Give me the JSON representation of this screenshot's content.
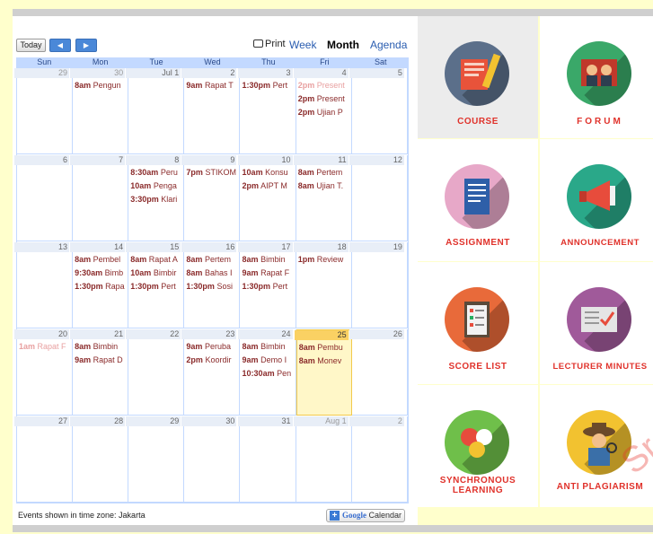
{
  "calendar": {
    "today_label": "Today",
    "print_label": "Print",
    "tabs": [
      "Week",
      "Month",
      "Agenda"
    ],
    "day_headers": [
      "Sun",
      "Mon",
      "Tue",
      "Wed",
      "Thu",
      "Fri",
      "Sat"
    ],
    "weeks": [
      [
        {
          "d": "29",
          "o": true,
          "ev": []
        },
        {
          "d": "30",
          "o": true,
          "ev": [
            [
              "8am",
              "Pengun"
            ]
          ]
        },
        {
          "d": "Jul 1",
          "ev": []
        },
        {
          "d": "2",
          "ev": [
            [
              "9am",
              "Rapat T"
            ]
          ]
        },
        {
          "d": "3",
          "ev": [
            [
              "1:30pm",
              "Pert"
            ]
          ]
        },
        {
          "d": "4",
          "ev": [
            [
              "2pm",
              "Present",
              true
            ],
            [
              "2pm",
              "Present"
            ],
            [
              "2pm",
              "Ujian P"
            ]
          ]
        },
        {
          "d": "5",
          "ev": []
        }
      ],
      [
        {
          "d": "6",
          "ev": []
        },
        {
          "d": "7",
          "ev": []
        },
        {
          "d": "8",
          "ev": [
            [
              "8:30am",
              "Peru"
            ],
            [
              "10am",
              "Penga"
            ],
            [
              "3:30pm",
              "Klari"
            ]
          ]
        },
        {
          "d": "9",
          "ev": [
            [
              "7pm",
              "STIKOM"
            ]
          ]
        },
        {
          "d": "10",
          "ev": [
            [
              "10am",
              "Konsu"
            ],
            [
              "2pm",
              "AIPT M"
            ]
          ]
        },
        {
          "d": "11",
          "ev": [
            [
              "8am",
              "Pertem"
            ],
            [
              "8am",
              "Ujian T."
            ]
          ]
        },
        {
          "d": "12",
          "ev": []
        }
      ],
      [
        {
          "d": "13",
          "ev": []
        },
        {
          "d": "14",
          "ev": [
            [
              "8am",
              "Pembel"
            ],
            [
              "9:30am",
              "Bimb"
            ],
            [
              "1:30pm",
              "Rapa"
            ]
          ]
        },
        {
          "d": "15",
          "ev": [
            [
              "8am",
              "Rapat A"
            ],
            [
              "10am",
              "Bimbir"
            ],
            [
              "1:30pm",
              "Pert"
            ]
          ]
        },
        {
          "d": "16",
          "ev": [
            [
              "8am",
              "Pertem"
            ],
            [
              "8am",
              "Bahas I"
            ],
            [
              "1:30pm",
              "Sosi"
            ]
          ]
        },
        {
          "d": "17",
          "ev": [
            [
              "8am",
              "Bimbin"
            ],
            [
              "9am",
              "Rapat F"
            ],
            [
              "1:30pm",
              "Pert"
            ]
          ]
        },
        {
          "d": "18",
          "ev": [
            [
              "1pm",
              "Review"
            ]
          ]
        },
        {
          "d": "19",
          "ev": []
        }
      ],
      [
        {
          "d": "20",
          "ev": [
            [
              "1am",
              "Rapat F",
              true
            ]
          ]
        },
        {
          "d": "21",
          "ev": [
            [
              "8am",
              "Bimbin"
            ],
            [
              "9am",
              "Rapat D"
            ]
          ]
        },
        {
          "d": "22",
          "ev": []
        },
        {
          "d": "23",
          "ev": [
            [
              "9am",
              "Peruba"
            ],
            [
              "2pm",
              "Koordir"
            ]
          ]
        },
        {
          "d": "24",
          "ev": [
            [
              "8am",
              "Bimbin"
            ],
            [
              "9am",
              "Demo I"
            ],
            [
              "10:30am",
              "Pen"
            ]
          ]
        },
        {
          "d": "25",
          "today": true,
          "ev": [
            [
              "8am",
              "Pembu"
            ],
            [
              "8am",
              "Monev"
            ]
          ]
        },
        {
          "d": "26",
          "ev": []
        }
      ],
      [
        {
          "d": "27",
          "ev": []
        },
        {
          "d": "28",
          "ev": []
        },
        {
          "d": "29",
          "ev": []
        },
        {
          "d": "30",
          "ev": []
        },
        {
          "d": "31",
          "ev": []
        },
        {
          "d": "Aug 1",
          "o": true,
          "ev": []
        },
        {
          "d": "2",
          "o": true,
          "ev": []
        }
      ]
    ],
    "footer_text": "Events shown in time zone: Jakarta",
    "gcal_plus": "+",
    "gcal_google": "Google",
    "gcal_label": "Calendar"
  },
  "tiles": [
    {
      "label": "COURSE",
      "circle": "#5b6f8a",
      "icon": "book-icon",
      "accent": "#e8533a"
    },
    {
      "label": "FORUM",
      "circle": "#3aa869",
      "icon": "forum-icon",
      "accent": "#c0392b"
    },
    {
      "label": "ASSIGNMENT",
      "circle": "#e7a8c8",
      "icon": "document-icon",
      "accent": "#2e5fa8"
    },
    {
      "label": "ANNOUNCEMENT",
      "circle": "#2aa889",
      "icon": "megaphone-icon",
      "accent": "#e74c3c"
    },
    {
      "label": "SCORE LIST",
      "circle": "#e86a3a",
      "icon": "clipboard-icon",
      "accent": "#f2f2f2"
    },
    {
      "label": "LECTURER MINUTES",
      "circle": "#a05a9a",
      "icon": "checklist-icon",
      "accent": "#e5e5e5"
    },
    {
      "label": "SYNCHRONOUS LEARNING",
      "circle": "#6fbf4a",
      "icon": "chat-bubbles-icon",
      "accent": "#e74c3c"
    },
    {
      "label": "ANTI PLAGIARISM",
      "circle": "#f2c230",
      "icon": "detective-icon",
      "accent": "#3a6fa8"
    }
  ],
  "watermark": "Sr"
}
